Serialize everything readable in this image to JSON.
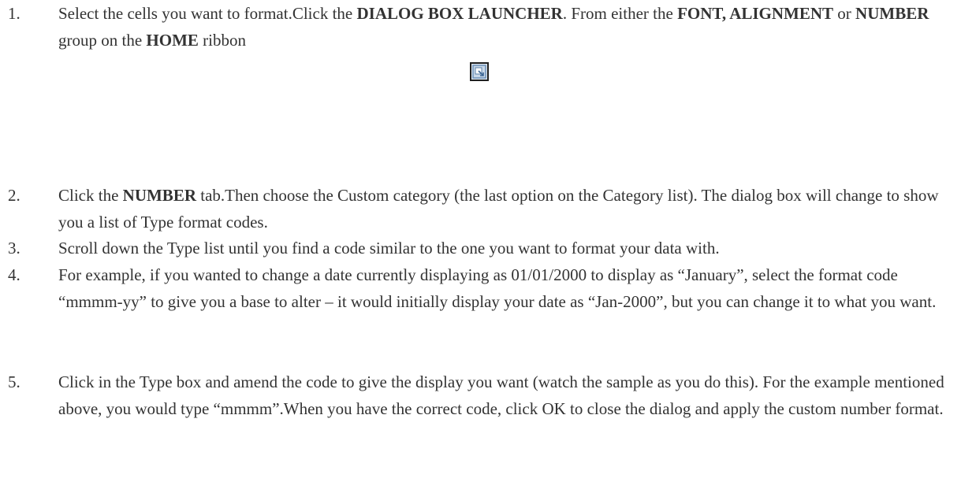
{
  "steps": [
    {
      "num": "1.",
      "parts": [
        {
          "t": "Select the cells you want to format.Click the "
        },
        {
          "t": "DIALOG BOX LAUNCHER",
          "b": true
        },
        {
          "t": ". From either the "
        },
        {
          "t": "FONT, ALIGNMENT",
          "b": true
        },
        {
          "t": " or "
        },
        {
          "t": "NUMBER",
          "b": true
        },
        {
          "t": " group on the "
        },
        {
          "t": "HOME",
          "b": true
        },
        {
          "t": " ribbon"
        }
      ]
    },
    {
      "num": "2.",
      "parts": [
        {
          "t": "Click the "
        },
        {
          "t": "NUMBER",
          "b": true
        },
        {
          "t": " tab.Then choose the Custom category (the last option on the Category list). The dialog box will change to show you a list of Type format codes."
        }
      ]
    },
    {
      "num": "3.",
      "parts": [
        {
          "t": "Scroll down the Type list until you find a code similar to the one you want to format your data with."
        }
      ]
    },
    {
      "num": "4.",
      "parts": [
        {
          "t": "For example, if you wanted to change a date currently displaying as 01/01/2000 to display as “January”, select the format code “mmmm-yy” to give you a base to alter – it would initially display your date as “Jan-2000”, but you can change it to what you want."
        }
      ]
    },
    {
      "num": "5.",
      "parts": [
        {
          "t": "Click in the Type box and amend the code to give the display you want (watch the sample as you do this). For the example mentioned above, you would type “mmmm”.When you have the correct code, click OK to close the dialog and apply the custom number format."
        }
      ]
    }
  ],
  "launcher_icon": "dialog-box-launcher-icon"
}
